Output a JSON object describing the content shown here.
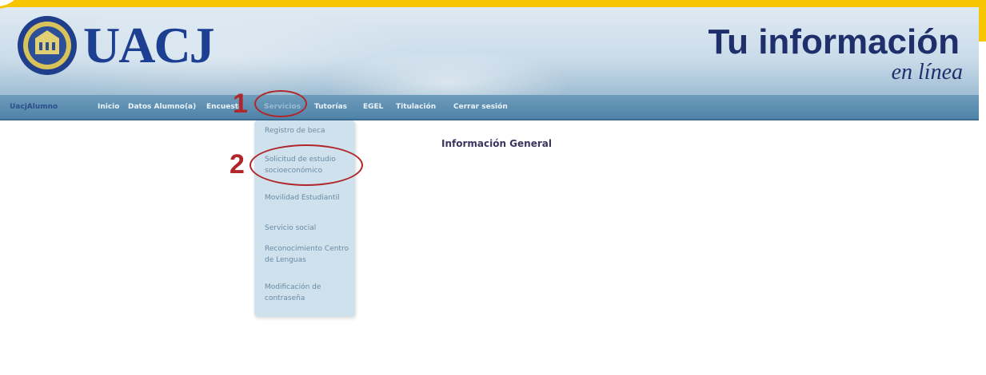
{
  "brand": {
    "logo_text": "UACJ",
    "tagline_main": "Tu información",
    "tagline_sub": "en línea"
  },
  "nav": {
    "user": "UacjAlumno",
    "items": [
      "Inicio",
      "Datos Alumno(a)",
      "Encuesta",
      "Servicios",
      "Tutorías",
      "EGEL",
      "Titulación",
      "Cerrar sesión"
    ]
  },
  "dropdown": {
    "items": [
      "Registro de beca",
      "Solicitud de estudio socioeconómico",
      "Movilidad Estudiantil",
      "Servicio social",
      "Reconocimiento Centro de Lenguas",
      "Modificación de contraseña"
    ]
  },
  "main": {
    "title": "Información General"
  },
  "annotations": {
    "step1": "1",
    "step2": "2"
  },
  "colors": {
    "frame": "#f6c400",
    "annotation": "#b0262a",
    "nav": "#4f83a8"
  }
}
